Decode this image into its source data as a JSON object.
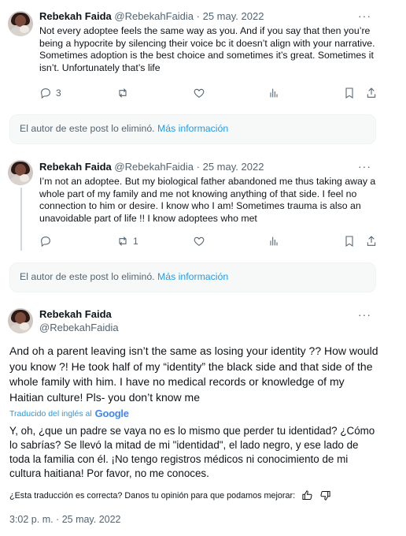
{
  "tweets": [
    {
      "name": "Rebekah Faida",
      "handle": "@RebekahFaidia",
      "date": "· 25 may. 2022",
      "text": "Not every adoptee feels the same way as you. And if you say that then you’re being a hypocrite by silencing their voice bc it doesn’t align with your narrative. Sometimes adoption is the best choice and sometimes it’s great. Sometimes it isn’t. Unfortunately that’s life",
      "reply_count": "3",
      "retweet_count": ""
    },
    {
      "name": "Rebekah Faida",
      "handle": "@RebekahFaidia",
      "date": "· 25 may. 2022",
      "text": "I’m not an adoptee. But my biological father abandoned me thus taking away a whole part of my family and me not knowing anything of that side. I feel no connection to him or desire. I know who I am! Sometimes trauma is also an unavoidable part of life !! I know adoptees who met",
      "reply_count": "",
      "retweet_count": "1"
    }
  ],
  "deleted_notice": {
    "text": "El autor de este post lo eliminó. ",
    "link": "Más información"
  },
  "main_tweet": {
    "name": "Rebekah Faida",
    "handle": "@RebekahFaidia",
    "text": "And oh a parent leaving isn’t the same as losing your identity ?? How would you know ?! He took half of my “identity” the black side and that side of the whole family with him. I have no medical records or knowledge of my Haitian culture! Pls- you don’t know me",
    "translated_by": "Traducido del inglés al",
    "translator": "Google",
    "translation": "Y, oh, ¿que un padre se vaya no es lo mismo que perder tu identidad? ¿Cómo lo sabrías? Se llevó la mitad de mi \"identidad\", el lado negro, y ese lado de toda la familia con él. ¡No tengo registros médicos ni conocimiento de mi cultura haitiana! Por favor, no me conoces.",
    "feedback": "¿Esta traducción es correcta? Danos tu opinión para que podamos mejorar:",
    "timestamp": "3:02 p. m. · 25 may. 2022"
  },
  "more_label": "···"
}
